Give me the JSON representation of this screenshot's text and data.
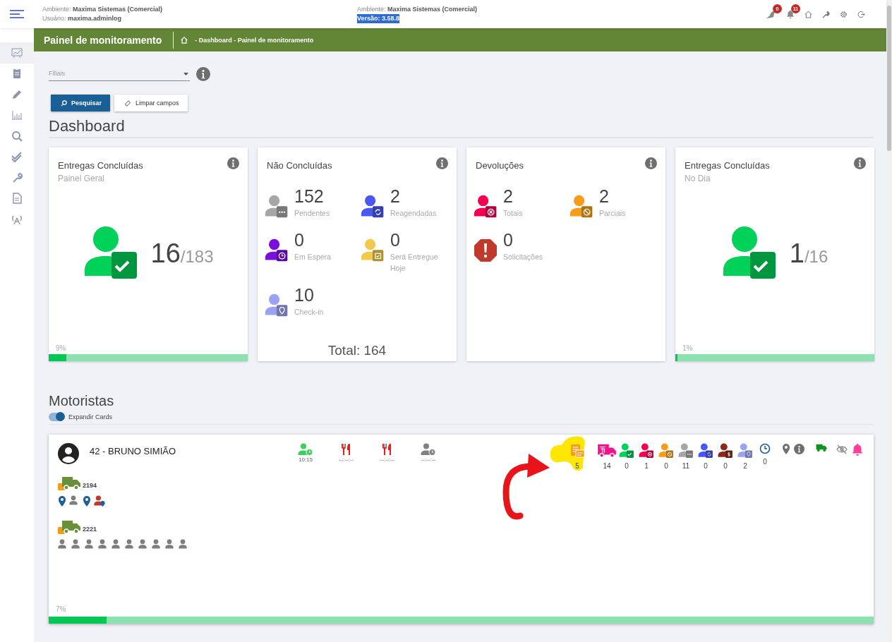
{
  "header": {
    "environment": {
      "label": "Ambiente:",
      "value": "Maxima Sistemas (Comercial)"
    },
    "user": {
      "label": "Usuário:",
      "value": "maxima.adminlog"
    },
    "environment_2": {
      "label": "Ambiente:",
      "value": "Maxima Sistemas (Comercial)"
    },
    "version": "Versão: 3.58.8",
    "badges": [
      {
        "kind": "bird",
        "count": "0"
      },
      {
        "kind": "bell",
        "count": "11"
      }
    ]
  },
  "sidebar": {
    "items": [
      {
        "kind": "chart",
        "selected": true
      },
      {
        "kind": "clipboard",
        "selected": false
      },
      {
        "kind": "pencil",
        "selected": false
      },
      {
        "kind": "bars",
        "selected": false
      },
      {
        "kind": "search",
        "selected": false
      },
      {
        "kind": "checks",
        "selected": false
      },
      {
        "kind": "wrench",
        "selected": false
      },
      {
        "kind": "document",
        "selected": false
      },
      {
        "kind": "antenna",
        "selected": false
      }
    ]
  },
  "title_bar": {
    "title": "Painel de monitoramento",
    "breadcrumb": "- Dashboard - Painel de monitoramento"
  },
  "filter": {
    "placeholder": "Filiais"
  },
  "buttons": [
    {
      "kind": "primary",
      "label": "Pesquisar"
    },
    {
      "kind": "secondary",
      "label": "Limpar campos"
    }
  ],
  "dashboard": {
    "title": "Dashboard",
    "cards": [
      {
        "kind": "big",
        "title": "Entregas Concluídas",
        "subtitle": "Painel Geral",
        "value": "16",
        "total": "/183",
        "percent": "9%",
        "level": 0.09
      },
      {
        "kind": "grid",
        "title": "Não Concluídas",
        "items": [
          {
            "value": "152",
            "label": "Pendentes",
            "color": "#a6a6a6",
            "kind": "dots"
          },
          {
            "value": "2",
            "label": "Reagendadas",
            "color": "#4a57f5",
            "kind": "sync"
          },
          {
            "value": "0",
            "label": "Em Espera",
            "color": "#7a0fdc",
            "kind": "clock"
          },
          {
            "value": "0",
            "label": "Será Entregue Hoje",
            "color": "#f2c94c",
            "kind": "calendar"
          },
          {
            "value": "10",
            "label": "Check-in",
            "color": "#9aa2f2",
            "kind": "pin"
          }
        ],
        "total": "Total: 164"
      },
      {
        "kind": "grid",
        "title": "Devoluções",
        "items": [
          {
            "value": "2",
            "label": "Totais",
            "color": "#f5004f",
            "kind": "cross"
          },
          {
            "value": "2",
            "label": "Parciais",
            "color": "#f59c1a",
            "kind": "block"
          },
          {
            "value": "0",
            "label": "Solicitações",
            "color": "#c0392b",
            "kind": "alert"
          }
        ]
      },
      {
        "kind": "big",
        "title": "Entregas Concluídas",
        "subtitle": "No Dia",
        "value": "1",
        "total": "/16",
        "percent": "1%",
        "level": 0.01
      }
    ]
  },
  "drivers": {
    "title": "Motoristas",
    "toggle": {
      "label": "Expandir Cards",
      "on": true
    },
    "cards": [
      {
        "name": "42 - BRUNO SIMIÃO",
        "times": [
          {
            "kind": "checkin",
            "color": "#3ccf5a",
            "text": "10:15"
          },
          {
            "kind": "meal",
            "color": "#f01818",
            "text": "--:--:--"
          },
          {
            "kind": "meal",
            "color": "#f01818",
            "text": "--:--:--"
          },
          {
            "kind": "checkout",
            "color": "#808080",
            "text": "--:--:--"
          }
        ],
        "stats": [
          {
            "kind": "docs",
            "color": "#f59c1a",
            "value": "5",
            "highlighted": true
          },
          {
            "kind": "truck",
            "color": "#f0148c",
            "value": "14",
            "highlighted": false
          },
          {
            "kind": "check",
            "color": "#00d158",
            "value": "0",
            "highlighted": false
          },
          {
            "kind": "cross",
            "color": "#f5004f",
            "value": "1",
            "highlighted": false
          },
          {
            "kind": "block",
            "color": "#f59c1a",
            "value": "0",
            "highlighted": false
          },
          {
            "kind": "dots",
            "color": "#a6a6a6",
            "value": "11",
            "highlighted": false
          },
          {
            "kind": "sync",
            "color": "#4a57f5",
            "value": "0",
            "highlighted": false
          },
          {
            "kind": "dollar",
            "color": "#8b2a1a",
            "value": "0",
            "highlighted": false
          },
          {
            "kind": "pin",
            "color": "#9aa2f2",
            "value": "2",
            "highlighted": false
          },
          {
            "kind": "clock",
            "color": "#1a5e96",
            "value": "0",
            "highlighted": false
          },
          {
            "kind": "pin-info",
            "color": "#707070",
            "highlighted": false
          },
          {
            "kind": "small-truck",
            "color": "#14921e",
            "highlighted": false
          },
          {
            "kind": "hidden-bell",
            "color": "#ff3d9a",
            "highlighted": false
          }
        ],
        "vehicles": [
          {
            "number": "2194",
            "stops": [
              {
                "kind": "pin"
              },
              {
                "kind": "person"
              },
              {
                "kind": "pin"
              },
              {
                "kind": "person-pin"
              }
            ]
          },
          {
            "number": "2221",
            "stops": [
              {
                "kind": "person"
              },
              {
                "kind": "person"
              },
              {
                "kind": "person"
              },
              {
                "kind": "person"
              },
              {
                "kind": "person"
              },
              {
                "kind": "person"
              },
              {
                "kind": "person"
              },
              {
                "kind": "person"
              },
              {
                "kind": "person"
              },
              {
                "kind": "person"
              }
            ]
          }
        ],
        "percent": "7%",
        "level": 0.07,
        "annotated": true
      }
    ]
  }
}
